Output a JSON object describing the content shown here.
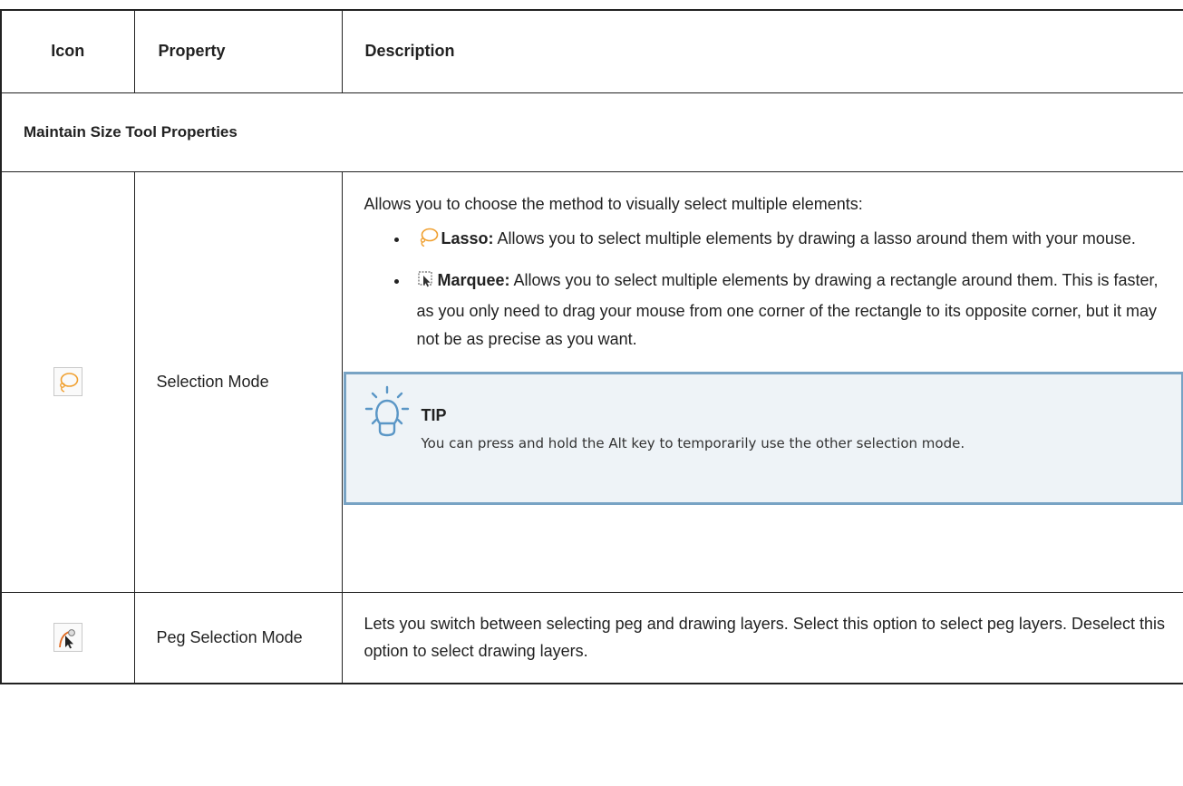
{
  "table": {
    "headers": {
      "icon": "Icon",
      "property": "Property",
      "description": "Description"
    },
    "section_title": "Maintain Size Tool Properties",
    "rows": [
      {
        "icon": "lasso-icon",
        "property": "Selection Mode",
        "intro": "Allows you to choose the method to visually select multiple elements:",
        "items": [
          {
            "icon": "lasso-icon",
            "term": "Lasso:",
            "text": " Allows you to select multiple elements by drawing a lasso around them with your mouse."
          },
          {
            "icon": "marquee-icon",
            "term": "Marquee:",
            "text": " Allows you to select multiple elements by drawing a rectangle around them. This is faster, as you only need to drag your mouse from one corner of the rectangle to its opposite corner, but it may not be as precise as you want."
          }
        ],
        "tip": {
          "title": "TIP",
          "text": "You can press and hold the Alt key to temporarily use the other selection mode."
        }
      },
      {
        "icon": "peg-selection-icon",
        "property": "Peg Selection Mode",
        "description": "Lets you switch between selecting peg and drawing layers. Select this option to select peg layers. Deselect this option to select drawing layers."
      }
    ]
  },
  "colors": {
    "border": "#222222",
    "tip_border": "#78a3c4",
    "tip_background": "#eef3f7",
    "lasso": "#f0a030"
  }
}
